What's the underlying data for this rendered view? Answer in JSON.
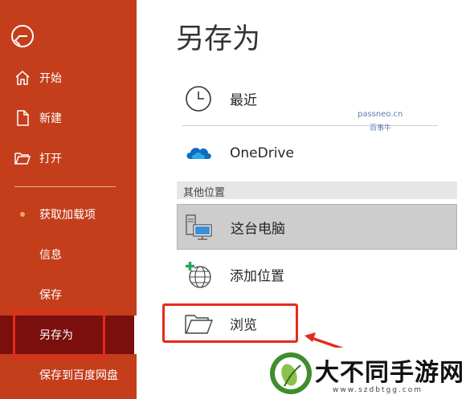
{
  "sidebar": {
    "items": [
      {
        "label": "开始",
        "icon": "home-icon"
      },
      {
        "label": "新建",
        "icon": "new-document-icon"
      },
      {
        "label": "打开",
        "icon": "folder-open-icon"
      },
      {
        "label": "获取加载项",
        "icon": "dot-icon"
      },
      {
        "label": "信息"
      },
      {
        "label": "保存"
      },
      {
        "label": "另存为",
        "active": true
      },
      {
        "label": "保存到百度网盘"
      }
    ]
  },
  "main": {
    "title": "另存为",
    "locations": [
      {
        "label": "最近",
        "icon": "clock-icon"
      },
      {
        "label": "OneDrive",
        "icon": "onedrive-cloud-icon"
      }
    ],
    "section_header": "其他位置",
    "other_locations": [
      {
        "label": "这台电脑",
        "icon": "this-pc-icon",
        "selected": true
      },
      {
        "label": "添加位置",
        "icon": "add-location-globe-icon"
      },
      {
        "label": "浏览",
        "icon": "folder-browse-icon"
      }
    ]
  },
  "watermark": {
    "line1": "passneo.cn",
    "line2": "百事牛"
  },
  "brand": {
    "text": "大不同手游网",
    "url": "www.szdbtgg.com"
  },
  "colors": {
    "sidebar_bg": "#c43e1c",
    "sidebar_active": "#7a0f0d",
    "highlight_box": "#e52b1b",
    "onedrive_blue": "#0f6cbd"
  }
}
